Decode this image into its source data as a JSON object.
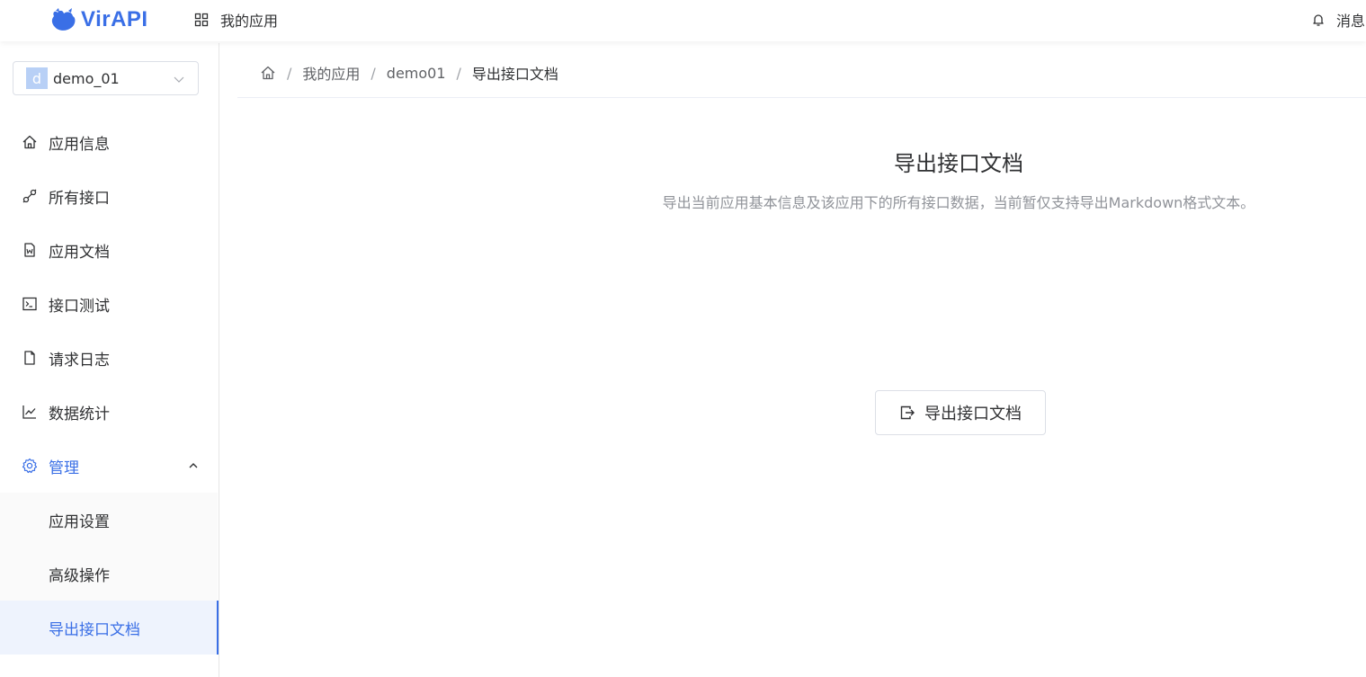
{
  "header": {
    "logo_text": "VirAPI",
    "apps_label": "我的应用",
    "messages_label": "消息"
  },
  "sidebar": {
    "app_select": {
      "avatar_letter": "d",
      "value": "demo_01"
    },
    "items": [
      {
        "label": "应用信息",
        "icon": "home-icon"
      },
      {
        "label": "所有接口",
        "icon": "link-icon"
      },
      {
        "label": "应用文档",
        "icon": "word-doc-icon"
      },
      {
        "label": "接口测试",
        "icon": "terminal-icon"
      },
      {
        "label": "请求日志",
        "icon": "file-icon"
      },
      {
        "label": "数据统计",
        "icon": "line-chart-icon"
      },
      {
        "label": "管理",
        "icon": "gear-icon"
      }
    ],
    "subitems": [
      {
        "label": "应用设置"
      },
      {
        "label": "高级操作"
      },
      {
        "label": "导出接口文档"
      }
    ]
  },
  "breadcrumb": {
    "items": [
      "我的应用",
      "demo01",
      "导出接口文档"
    ],
    "separator": "/"
  },
  "main": {
    "title": "导出接口文档",
    "description": "导出当前应用基本信息及该应用下的所有接口数据，当前暂仅支持导出Markdown格式文本。",
    "export_button_label": "导出接口文档"
  },
  "colors": {
    "accent": "#3a6fe6",
    "text": "#303133",
    "muted": "#909399"
  }
}
